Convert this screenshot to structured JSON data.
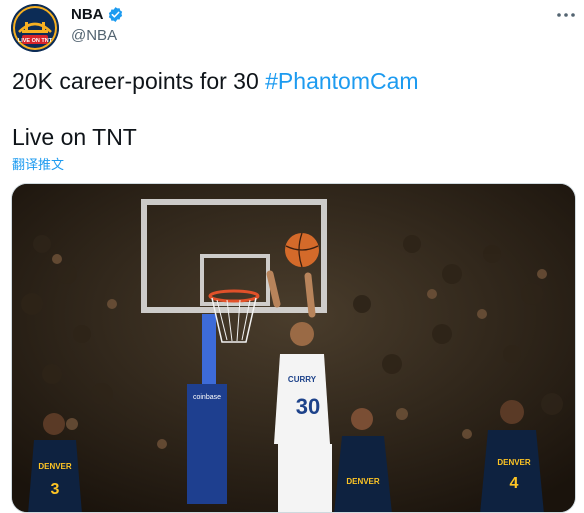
{
  "author": {
    "name": "NBA",
    "handle": "@NBA",
    "avatar_icon": "golden-state-warriors-city-logo",
    "avatar_text": "LIVE ON TNT",
    "verified_icon": "verified-badge-icon"
  },
  "tweet": {
    "text_prefix": "20K career-points for 30 ",
    "hashtag": "#PhantomCam",
    "line2": "Live on TNT",
    "translate_link": "翻译推文"
  },
  "media": {
    "description_icon": "basketball-shot-video",
    "backboard_brand": "coinbase",
    "jersey_number_shooter": "30",
    "jersey_name_shooter": "CURRY",
    "defender_team": "DENVER",
    "defender_left_number": "3",
    "defender_right_number": "4"
  },
  "colors": {
    "accent": "#1d9bf0",
    "text": "#0f1419",
    "secondary": "#536471",
    "warriors_navy": "#0c2c56",
    "warriors_gold": "#f6b021"
  }
}
